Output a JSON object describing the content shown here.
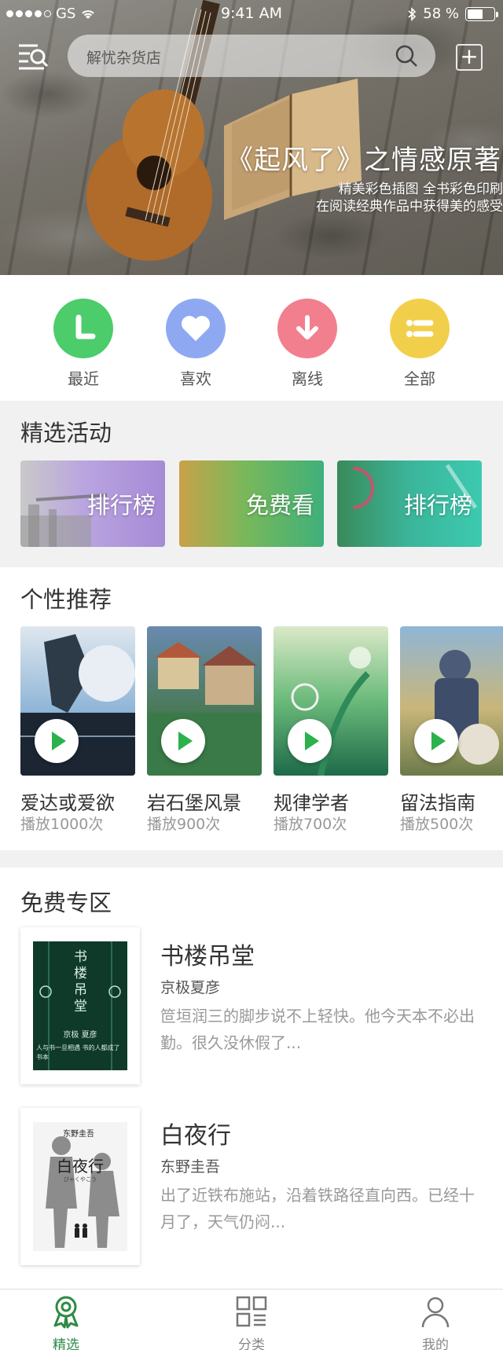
{
  "status_bar": {
    "carrier": "GS",
    "time": "9:41 AM",
    "battery": "58 %",
    "battery_level": 0.58,
    "signal_bars_filled": 4,
    "signal_bars_total": 5
  },
  "header": {
    "search_placeholder": "解忧杂货店",
    "icons": [
      "menu-icon",
      "search-icon",
      "add-icon"
    ]
  },
  "banner": {
    "title": "《起风了》之情感原著",
    "subtitle_line1": "精美彩色插图 全书彩色印刷",
    "subtitle_line2": "在阅读经典作品中获得美的感受"
  },
  "quick_actions": [
    {
      "label": "最近",
      "icon": "clock-icon",
      "color": "#4ccc6a"
    },
    {
      "label": "喜欢",
      "icon": "heart-icon",
      "color": "#8fa8f2"
    },
    {
      "label": "离线",
      "icon": "download-icon",
      "color": "#f27f8d"
    },
    {
      "label": "全部",
      "icon": "list-icon",
      "color": "#f2cf4a"
    }
  ],
  "activities": {
    "title": "精选活动",
    "items": [
      {
        "label": "排行榜",
        "color": "#a68ad6"
      },
      {
        "label": "免费看",
        "color": "#49b87a"
      },
      {
        "label": "排行榜",
        "color": "#3cc2a6"
      }
    ]
  },
  "recommend": {
    "title": "个性推荐",
    "items": [
      {
        "title": "爱达或爱欲",
        "plays": "播放1000次"
      },
      {
        "title": "岩石堡风景",
        "plays": "播放900次"
      },
      {
        "title": "规律学者",
        "plays": "播放700次"
      },
      {
        "title": "留法指南",
        "plays": "播放500次"
      }
    ]
  },
  "free_zone": {
    "title": "免费专区",
    "books": [
      {
        "title": "书楼吊堂",
        "author": "京极夏彦",
        "desc": "笸垣润三的脚步说不上轻快。他今天本不必出勤。很久没休假了...",
        "cover_title": "书楼吊堂",
        "cover_author": "京极 夏彦",
        "cover_tagline": "人与书一旦相遇 书的人都成了书本"
      },
      {
        "title": "白夜行",
        "author": "东野圭吾",
        "desc": "出了近铁布施站，沿着铁路径直向西。已经十月了，天气仍闷...",
        "cover_title": "白夜行",
        "cover_author": "东野圭吾",
        "cover_romaji": "びゃくやこう"
      }
    ]
  },
  "tabbar": [
    {
      "label": "精选",
      "icon": "award-icon",
      "active": true
    },
    {
      "label": "分类",
      "icon": "grid-list-icon",
      "active": false
    },
    {
      "label": "我的",
      "icon": "user-icon",
      "active": false
    }
  ],
  "accent_color": "#2bb24c"
}
